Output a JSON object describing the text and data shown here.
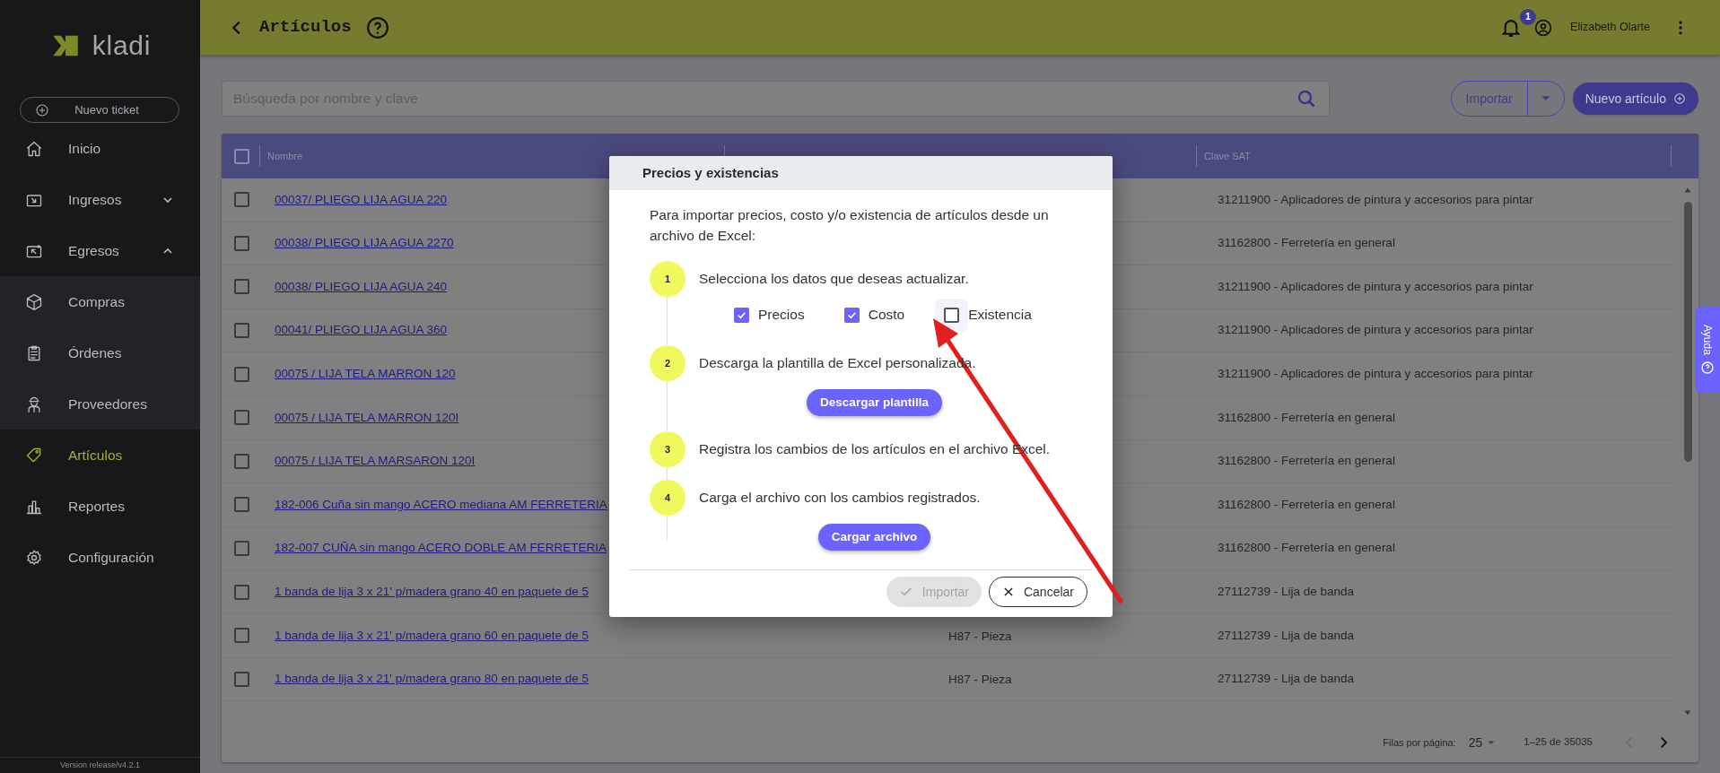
{
  "sidebar": {
    "logo": "kladi",
    "new_ticket": "Nuevo ticket",
    "items": [
      {
        "label": "Inicio",
        "selected": false
      },
      {
        "label": "Ingresos",
        "selected": false,
        "expanded": false
      },
      {
        "label": "Egresos",
        "selected": false,
        "expanded": true,
        "children": [
          {
            "label": "Compras",
            "selected": false
          },
          {
            "label": "Órdenes",
            "selected": false
          },
          {
            "label": "Proveedores",
            "selected": false
          }
        ]
      },
      {
        "label": "Artículos",
        "selected": true
      },
      {
        "label": "Reportes",
        "selected": false
      },
      {
        "label": "Configuración",
        "selected": false
      }
    ],
    "version": "Version release/v4.2.1"
  },
  "header": {
    "title": "Artículos",
    "notifications": "1",
    "user": "Elizabeth Olarte"
  },
  "search": {
    "placeholder": "Búsqueda por nombre y clave"
  },
  "actions": {
    "import": "Importar",
    "new": "Nuevo artículo"
  },
  "table": {
    "select_all_checked": false,
    "columns": [
      "Nombre",
      "Clave SAT"
    ],
    "rows": [
      {
        "name": "00037/ PLIEGO LIJA AGUA 220",
        "unit": "",
        "sat": "31211900 - Aplicadores de pintura y accesorios para pintar",
        "checked": false
      },
      {
        "name": "00038/ PLIEGO LIJA AGUA 2270",
        "unit": "",
        "sat": "31162800 - Ferretería en general",
        "checked": false
      },
      {
        "name": "00038/ PLIEGO LIJA AGUA 240",
        "unit": "",
        "sat": "31211900 - Aplicadores de pintura y accesorios para pintar",
        "checked": false
      },
      {
        "name": "00041/ PLIEGO LIJA AGUA 360",
        "unit": "",
        "sat": "31211900 - Aplicadores de pintura y accesorios para pintar",
        "checked": false
      },
      {
        "name": "00075 / LIJA TELA MARRON 120",
        "unit": "",
        "sat": "31211900 - Aplicadores de pintura y accesorios para pintar",
        "checked": false
      },
      {
        "name": "00075 / LIJA TELA MARRON 120I",
        "unit": "",
        "sat": "31162800 - Ferretería en general",
        "checked": false
      },
      {
        "name": "00075 / LIJA TELA MARSARON 120I",
        "unit": "",
        "sat": "31162800 - Ferretería en general",
        "checked": false
      },
      {
        "name": "182-006 Cuña sin mango ACERO mediana AM FERRETERIA",
        "unit": "",
        "sat": "31162800 - Ferretería en general",
        "checked": false
      },
      {
        "name": "182-007 CUÑA sin mango ACERO DOBLE AM FERRETERIA",
        "unit": "",
        "sat": "31162800 - Ferretería en general",
        "checked": false
      },
      {
        "name": "1 banda de lija 3 x 21' p/madera grano 40 en paquete de 5",
        "unit": "",
        "sat": "27112739 - Lija de banda",
        "checked": false
      },
      {
        "name": "1 banda de lija 3 x 21' p/madera grano 60 en paquete de 5",
        "unit": "H87 - Pieza",
        "sat": "27112739 - Lija de banda",
        "checked": false
      },
      {
        "name": "1 banda de lija 3 x 21' p/madera grano 80 en paquete de 5",
        "unit": "H87 - Pieza",
        "sat": "27112739 - Lija de banda",
        "checked": false
      }
    ]
  },
  "pagination": {
    "rows_label": "Filas por página:",
    "rows_per_page": "25",
    "range": "1–25 de 35035",
    "prev_disabled": true,
    "next_disabled": false
  },
  "help_tab": "Ayuda",
  "dialog": {
    "title": "Precios y existencias",
    "intro": "Para importar precios, costo y/o existencia de artículos desde un archivo de Excel:",
    "steps": [
      {
        "number": "1",
        "text": "Selecciona los datos que deseas actualizar.",
        "kind": "checkboxes",
        "options": [
          {
            "label": "Precios",
            "checked": true
          },
          {
            "label": "Costo",
            "checked": true
          },
          {
            "label": "Existencia",
            "checked": false
          }
        ]
      },
      {
        "number": "2",
        "text": "Descarga la plantilla de Excel personalizada.",
        "kind": "button",
        "button": "Descargar plantilla"
      },
      {
        "number": "3",
        "text": "Registra los cambios de los artículos en el archivo Excel.",
        "kind": "plain"
      },
      {
        "number": "4",
        "text": "Carga el archivo con los cambios registrados.",
        "kind": "button",
        "button": "Cargar archivo"
      }
    ],
    "import_button": {
      "label": "Importar",
      "disabled": true
    },
    "cancel_button": "Cancelar"
  }
}
